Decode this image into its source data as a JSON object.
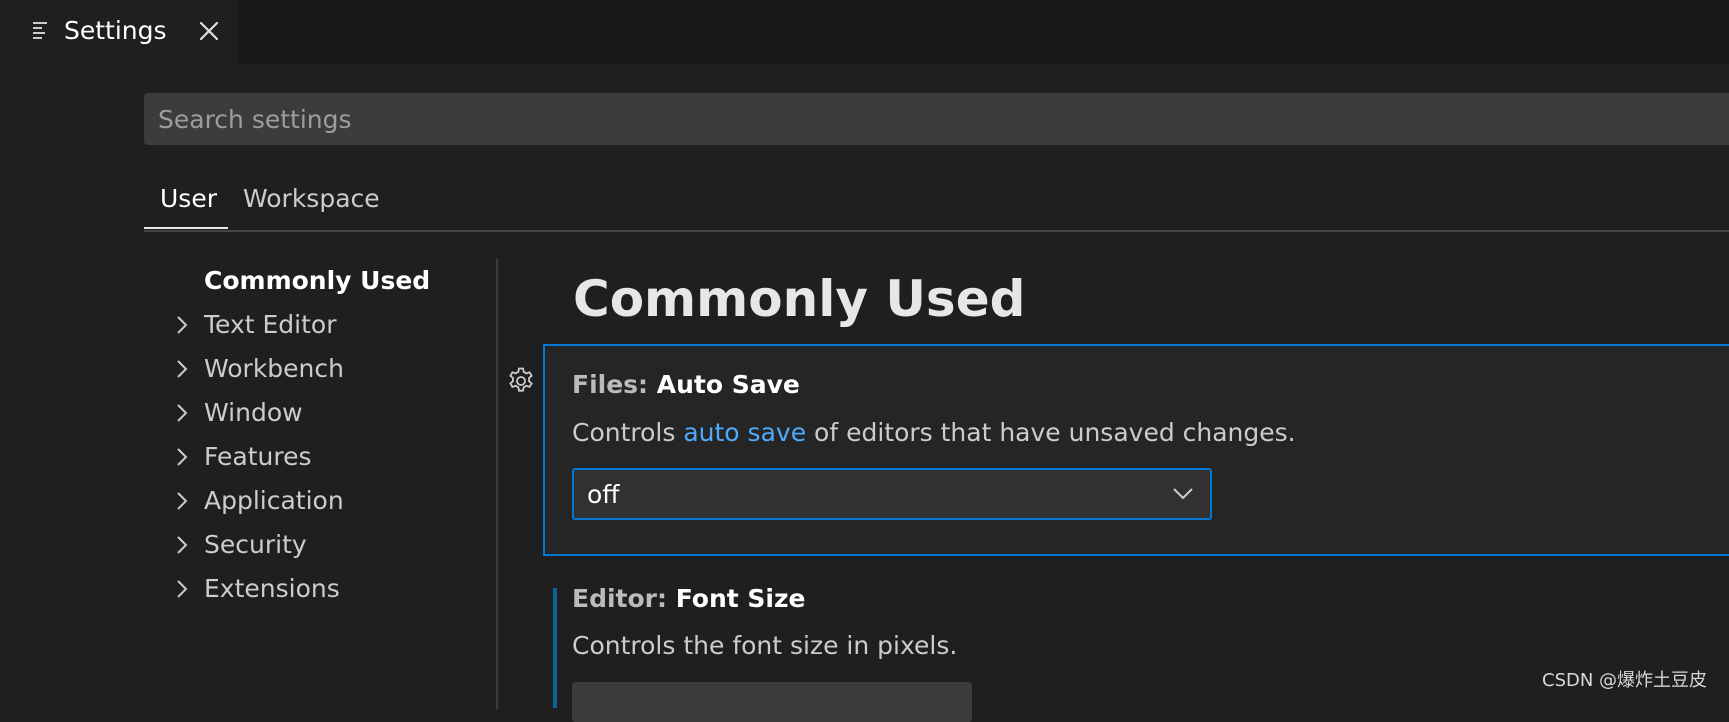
{
  "editor_tab": {
    "label": "Settings",
    "icon": "settings-editor-icon",
    "close_icon": "close-icon"
  },
  "search": {
    "placeholder": "Search settings",
    "value": ""
  },
  "scope_tabs": [
    {
      "label": "User",
      "active": true
    },
    {
      "label": "Workspace",
      "active": false
    }
  ],
  "toc": [
    {
      "label": "Commonly Used",
      "active": true,
      "expandable": false
    },
    {
      "label": "Text Editor",
      "expandable": true
    },
    {
      "label": "Workbench",
      "expandable": true
    },
    {
      "label": "Window",
      "expandable": true
    },
    {
      "label": "Features",
      "expandable": true
    },
    {
      "label": "Application",
      "expandable": true
    },
    {
      "label": "Security",
      "expandable": true
    },
    {
      "label": "Extensions",
      "expandable": true
    }
  ],
  "main": {
    "section_title": "Commonly Used",
    "settings": [
      {
        "category": "Files: ",
        "name": "Auto Save",
        "description_before": "Controls ",
        "description_link": "auto save",
        "description_after": " of editors that have unsaved changes.",
        "control": "dropdown",
        "value": "off",
        "focused": true
      },
      {
        "category": "Editor: ",
        "name": "Font Size",
        "description": "Controls the font size in pixels.",
        "control": "number-input",
        "modified": true
      }
    ]
  },
  "watermark": "CSDN @爆炸土豆皮",
  "colors": {
    "background": "#1f1f1f",
    "tabbar": "#181818",
    "focus_border": "#0078d4",
    "link": "#4daafc",
    "input_background": "#3c3c3c"
  }
}
